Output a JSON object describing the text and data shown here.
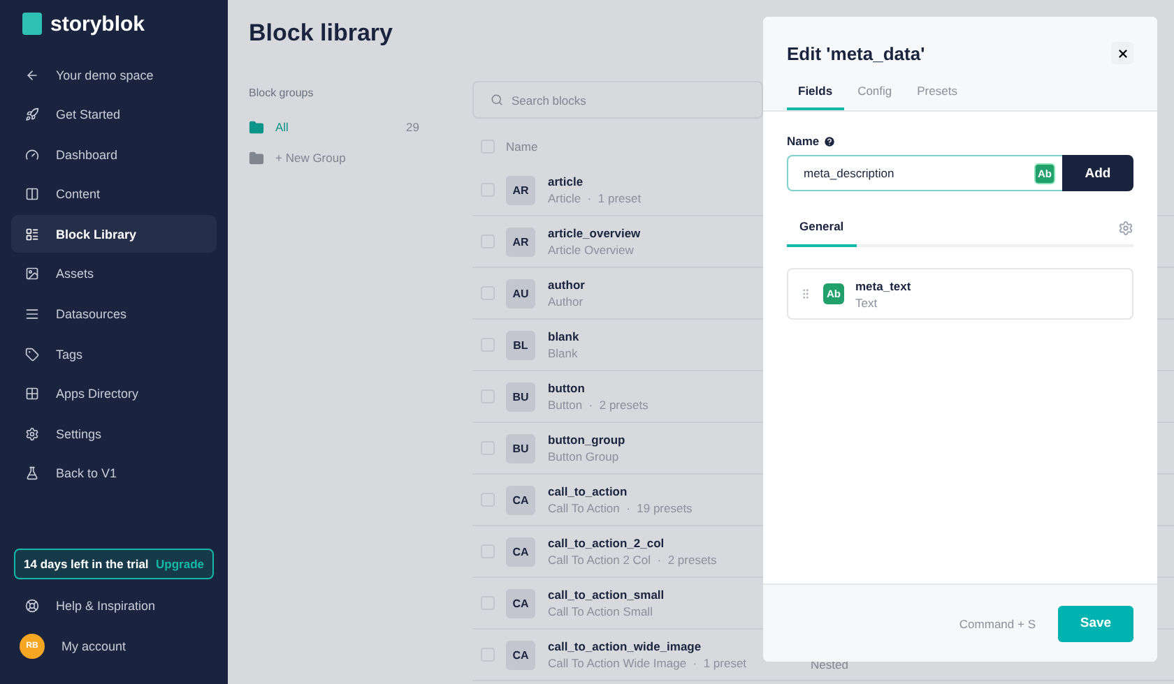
{
  "sidebar": {
    "logo": "storyblok",
    "back": {
      "label": "Your demo space"
    },
    "items": [
      {
        "label": "Get Started",
        "kind": "rocket",
        "selected": false
      },
      {
        "label": "Dashboard",
        "kind": "gauge",
        "selected": false
      },
      {
        "label": "Content",
        "kind": "content",
        "selected": false
      },
      {
        "label": "Block Library",
        "kind": "blocks",
        "selected": true
      },
      {
        "label": "Assets",
        "kind": "image",
        "selected": false
      },
      {
        "label": "Datasources",
        "kind": "list",
        "selected": false
      },
      {
        "label": "Tags",
        "kind": "tag",
        "selected": false
      },
      {
        "label": "Apps Directory",
        "kind": "apps",
        "selected": false
      },
      {
        "label": "Settings",
        "kind": "settings",
        "selected": false
      },
      {
        "label": "Back to V1",
        "kind": "flask",
        "selected": false
      }
    ],
    "trial": {
      "text": "14 days left in the trial",
      "action": "Upgrade"
    },
    "help": "Help & Inspiration",
    "account": {
      "initials": "RB",
      "label": "My account"
    }
  },
  "page": {
    "title": "Block library",
    "groups": {
      "heading": "Block groups",
      "items": [
        {
          "label": "All",
          "count": "29",
          "selected": true
        },
        {
          "label": "+ New Group",
          "selected": false
        }
      ]
    },
    "search": {
      "placeholder": "Search blocks"
    },
    "table": {
      "columns": [
        "Name"
      ],
      "all_checked": false,
      "rows": [
        {
          "abbr": "AR",
          "name": "article",
          "subtitle": "Article  ·  1 preset",
          "checked": false
        },
        {
          "abbr": "AR",
          "name": "article_overview",
          "subtitle": "Article Overview",
          "checked": false
        },
        {
          "abbr": "AU",
          "name": "author",
          "subtitle": "Author",
          "checked": false
        },
        {
          "abbr": "BL",
          "name": "blank",
          "subtitle": "Blank",
          "checked": false
        },
        {
          "abbr": "BU",
          "name": "button",
          "subtitle": "Button  ·  2 presets",
          "checked": false
        },
        {
          "abbr": "BU",
          "name": "button_group",
          "subtitle": "Button Group",
          "checked": false
        },
        {
          "abbr": "CA",
          "name": "call_to_action",
          "subtitle": "Call To Action  ·  19 presets",
          "checked": false
        },
        {
          "abbr": "CA",
          "name": "call_to_action_2_col",
          "subtitle": "Call To Action 2 Col  ·  2 presets",
          "checked": false
        },
        {
          "abbr": "CA",
          "name": "call_to_action_small",
          "subtitle": "Call To Action Small",
          "checked": false
        },
        {
          "abbr": "CA",
          "name": "call_to_action_wide_image",
          "subtitle": "Call To Action Wide Image  ·  1 preset",
          "column_2": "Nested",
          "checked": false
        }
      ]
    }
  },
  "panel": {
    "title": "Edit 'meta_data'",
    "tabs": [
      {
        "label": "Fields",
        "selected": true
      },
      {
        "label": "Config",
        "selected": false
      },
      {
        "label": "Presets",
        "selected": false
      }
    ],
    "name_label": "Name",
    "name_value": "meta_description",
    "type_badge": "Ab",
    "add": "Add",
    "section_tabs": [
      {
        "label": "General",
        "selected": true
      }
    ],
    "fields": [
      {
        "badge": "Ab",
        "name": "meta_text",
        "type": "Text"
      }
    ],
    "shortcut": "Command + S",
    "save": "Save"
  }
}
